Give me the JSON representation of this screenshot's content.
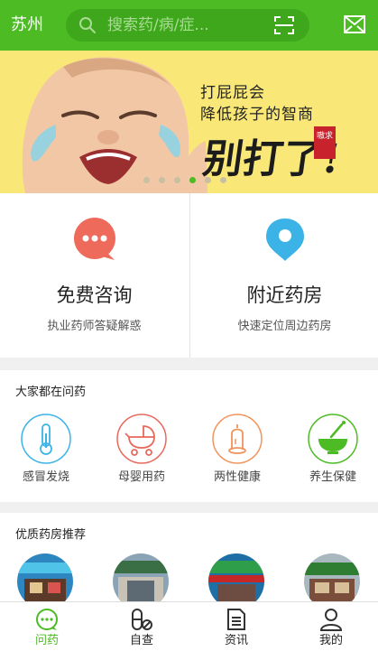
{
  "header": {
    "city": "苏州",
    "search_placeholder": "搜索药/病/症...",
    "brand_color": "#4cbb24"
  },
  "banner": {
    "line1": "打屁屁会",
    "line2": "降低孩子的智商",
    "line3": "别打了!",
    "seal": "嗷求",
    "slide_count": 6,
    "active_slide": 4
  },
  "services": [
    {
      "icon": "chat-bubble-icon",
      "title": "免费咨询",
      "subtitle": "执业药师答疑解惑"
    },
    {
      "icon": "location-pin-icon",
      "title": "附近药房",
      "subtitle": "快速定位周边药房"
    }
  ],
  "popular": {
    "title": "大家都在问药",
    "items": [
      {
        "icon": "thermometer-icon",
        "label": "感冒发烧",
        "color": "#3bb3e6"
      },
      {
        "icon": "baby-stroller-icon",
        "label": "母婴用药",
        "color": "#e8685b"
      },
      {
        "icon": "condom-icon",
        "label": "两性健康",
        "color": "#f0945b"
      },
      {
        "icon": "mortar-bowl-icon",
        "label": "养生保健",
        "color": "#4cbb24"
      }
    ]
  },
  "pharmacies": {
    "title": "优质药房推荐"
  },
  "bottom_nav": [
    {
      "icon": "chat-icon",
      "label": "问药",
      "active": true
    },
    {
      "icon": "pill-check-icon",
      "label": "自查",
      "active": false
    },
    {
      "icon": "news-icon",
      "label": "资讯",
      "active": false
    },
    {
      "icon": "person-icon",
      "label": "我的",
      "active": false
    }
  ]
}
